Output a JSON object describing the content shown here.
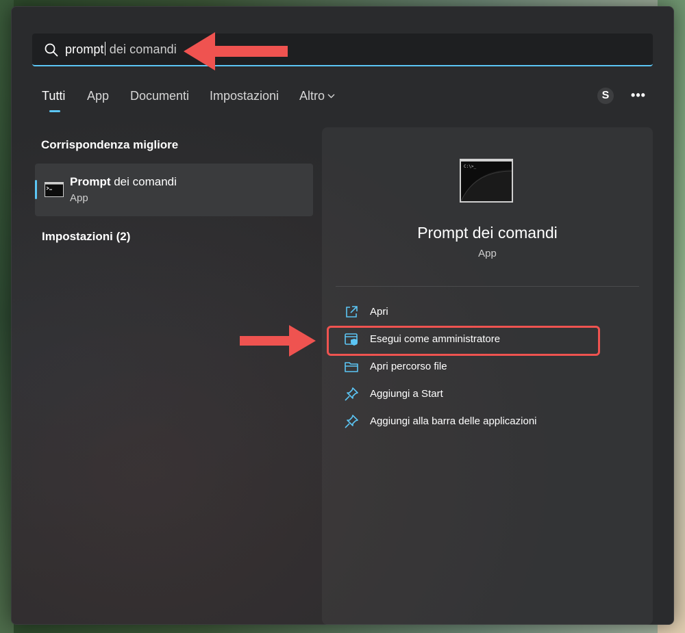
{
  "search": {
    "typed": "prompt",
    "suggestion": " dei comandi",
    "icon": "search-icon"
  },
  "tabs": [
    {
      "label": "Tutti",
      "active": true
    },
    {
      "label": "App",
      "active": false
    },
    {
      "label": "Documenti",
      "active": false
    },
    {
      "label": "Impostazioni",
      "active": false
    },
    {
      "label": "Altro",
      "active": false,
      "icon": "chevron-down-icon"
    }
  ],
  "header": {
    "avatar_letter": "S",
    "more_label": "•••"
  },
  "results": {
    "best_match_title": "Corrispondenza migliore",
    "best_match": {
      "name_bold": "Prompt",
      "name_rest": " dei comandi",
      "type": "App",
      "icon": "command-prompt-icon"
    },
    "settings_title": "Impostazioni (2)"
  },
  "detail": {
    "title": "Prompt dei comandi",
    "type": "App",
    "icon": "command-prompt-icon",
    "actions": [
      {
        "label": "Apri",
        "icon": "open-external-icon"
      },
      {
        "label": "Esegui come amministratore",
        "icon": "shield-window-icon"
      },
      {
        "label": "Apri percorso file",
        "icon": "folder-icon"
      },
      {
        "label": "Aggiungi a Start",
        "icon": "pin-icon"
      },
      {
        "label": "Aggiungi alla barra delle applicazioni",
        "icon": "pin-icon"
      }
    ]
  },
  "colors": {
    "accent": "#5cc6f5",
    "annotation_red": "#ef5350",
    "panel_bg": "#2a2b2d"
  }
}
